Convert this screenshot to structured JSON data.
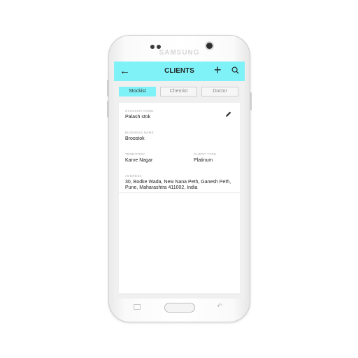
{
  "device": {
    "brand": "SAMSUNG"
  },
  "appbar": {
    "title": "CLIENTS",
    "back_icon": "arrow-left-icon",
    "add_icon": "plus-icon",
    "search_icon": "search-icon",
    "background": "#7ff2f8"
  },
  "tabs": [
    {
      "label": "Stockist",
      "active": true
    },
    {
      "label": "Chemist",
      "active": false
    },
    {
      "label": "Doctor",
      "active": false
    }
  ],
  "client": {
    "stockist_name_label": "STOCKIST NAME",
    "stockist_name": "Palash stok",
    "business_name_label": "BUSINESS NAME",
    "business_name": "Broostok",
    "territory_label": "TERRITORY",
    "territory": "Karve Nagar",
    "client_type_label": "CLIENT TYPE",
    "client_type": "Platinum",
    "address_label": "ADDRESS",
    "address_line1": "30, Bodke Wada, New Nana Peth, Ganesh Peth,",
    "address_line2": "Pune, Maharashtra 411002, India"
  }
}
